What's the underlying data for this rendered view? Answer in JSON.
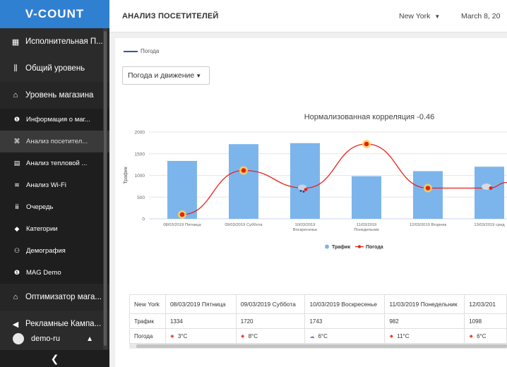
{
  "app": {
    "logo": "V-COUNT"
  },
  "sidebar": {
    "items": [
      {
        "label": "Исполнительная П...",
        "icon": "dashboard-icon",
        "glyph": "▦"
      },
      {
        "label": "Общий уровень",
        "icon": "bar-chart-icon",
        "glyph": "⫼"
      },
      {
        "label": "Уровень магазина",
        "icon": "store-icon",
        "glyph": "⌂"
      }
    ],
    "subitems": [
      {
        "label": "Информация о маг...",
        "icon": "info-icon",
        "glyph": "❶"
      },
      {
        "label": "Анализ посетител...",
        "icon": "visitors-icon",
        "glyph": "⌘"
      },
      {
        "label": "Анализ тепловой ...",
        "icon": "heatmap-icon",
        "glyph": "▤"
      },
      {
        "label": "Анализ Wi-Fi",
        "icon": "wifi-icon",
        "glyph": "≋"
      },
      {
        "label": "Очередь",
        "icon": "queue-icon",
        "glyph": "ⅲ"
      },
      {
        "label": "Категории",
        "icon": "tag-icon",
        "glyph": "◆"
      },
      {
        "label": "Демография",
        "icon": "people-icon",
        "glyph": "⚇"
      },
      {
        "label": "MAG Demo",
        "icon": "info-icon",
        "glyph": "❶"
      }
    ],
    "bottom_items": [
      {
        "label": "Оптимизатор мага...",
        "icon": "optimizer-icon",
        "glyph": "⌂"
      },
      {
        "label": "Рекламные Кампа...",
        "icon": "megaphone-icon",
        "glyph": "◀"
      }
    ],
    "user": {
      "name": "demo-ru"
    },
    "collapse_glyph": "❮"
  },
  "header": {
    "title": "АНАЛИЗ ПОСЕТИТЕЛЕЙ",
    "city": "New York",
    "date": "March 8, 20"
  },
  "content": {
    "legend_top": "Погода",
    "mode_select": "Погода и движение"
  },
  "chart_data": {
    "type": "bar",
    "title": "Нормализованная корреляция -0.46",
    "ylabel": "Трафик",
    "ylim": [
      0,
      2000
    ],
    "yticks": [
      0,
      500,
      1000,
      1500,
      2000
    ],
    "categories": [
      "08/03/2019 Пятница",
      "09/03/2019 Суббота",
      "10/03/2019 Воскресенье",
      "11/03/2019 Понедельник",
      "12/03/2019 Вторник",
      "13/03/2019 сред"
    ],
    "category_lines": [
      [
        "08/03/2019 Пятница"
      ],
      [
        "09/03/2019 Суббота"
      ],
      [
        "10/03/2019",
        "Воскресенье"
      ],
      [
        "11/03/2019",
        "Понедельник"
      ],
      [
        "12/03/2019 Вторник"
      ],
      [
        "13/03/2019 сред"
      ]
    ],
    "series": [
      {
        "name": "Трафик",
        "type": "bar",
        "color": "#7cb5ec",
        "values": [
          1334,
          1720,
          1743,
          982,
          1098,
          1200
        ]
      },
      {
        "name": "Погода",
        "type": "line",
        "color": "#e8211a",
        "values": [
          3,
          8,
          6,
          11,
          6,
          6
        ]
      }
    ],
    "weather_icons": [
      "sun",
      "sun",
      "snow",
      "sun",
      "sun",
      "cloud"
    ],
    "legend": [
      "Трафик",
      "Погода"
    ],
    "grid": true
  },
  "table": {
    "header": [
      "New York",
      "08/03/2019 Пятница",
      "09/03/2019 Суббота",
      "10/03/2019 Воскресенье",
      "11/03/2019 Понедельник",
      "12/03/201"
    ],
    "traffic_label": "Трафик",
    "traffic": [
      "1334",
      "1720",
      "1743",
      "982",
      "1098"
    ],
    "weather_label": "Погода",
    "weather": [
      {
        "icon": "sun-icon",
        "glyph": "✸",
        "temp": "3°C"
      },
      {
        "icon": "sun-icon",
        "glyph": "✸",
        "temp": "8°C"
      },
      {
        "icon": "snow-icon",
        "glyph": "☁",
        "temp": "6°C"
      },
      {
        "icon": "sun-icon",
        "glyph": "✸",
        "temp": "11°C"
      },
      {
        "icon": "sun-icon",
        "glyph": "✸",
        "temp": "6°C"
      }
    ]
  }
}
